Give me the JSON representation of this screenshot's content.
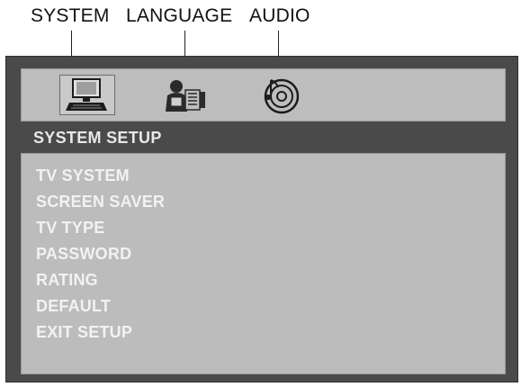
{
  "callouts": {
    "system": "SYSTEM",
    "language": "LANGUAGE",
    "audio": "AUDIO"
  },
  "tabs": [
    {
      "id": "system",
      "icon": "computer-icon",
      "selected": true
    },
    {
      "id": "language",
      "icon": "language-icon",
      "selected": false
    },
    {
      "id": "audio",
      "icon": "audio-disc-icon",
      "selected": false
    }
  ],
  "section_title": "SYSTEM SETUP",
  "menu": {
    "items": [
      "TV SYSTEM",
      "SCREEN SAVER",
      "TV TYPE",
      "PASSWORD",
      "RATING",
      "DEFAULT",
      "EXIT SETUP"
    ]
  },
  "colors": {
    "panel": "#4a4a4a",
    "icon_bar": "#bdbdbd",
    "menu_box": "#bcbcbc",
    "menu_text": "#f2f2f2"
  }
}
